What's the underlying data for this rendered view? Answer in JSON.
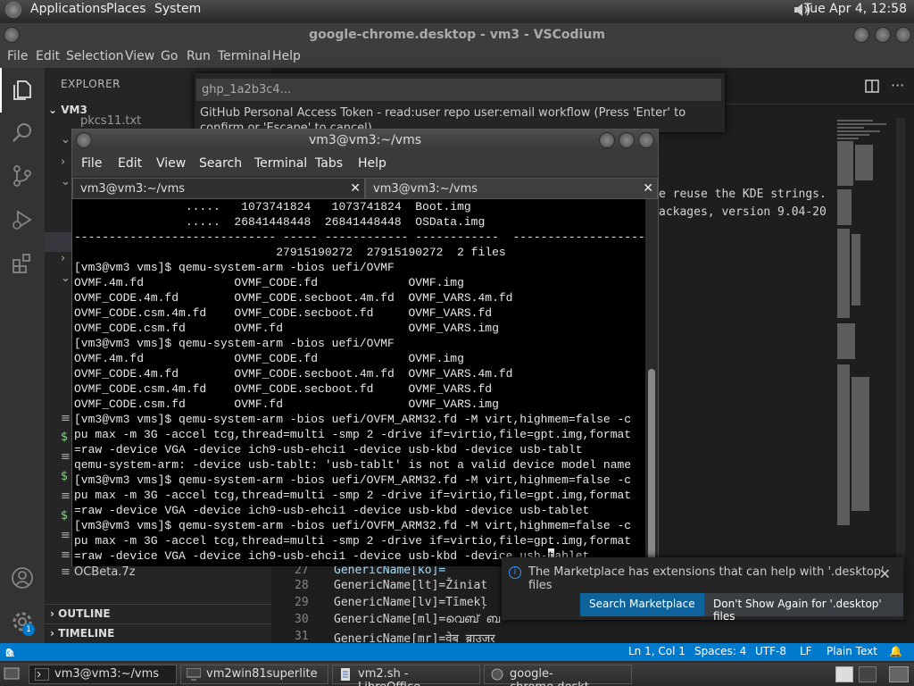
{
  "top_panel": {
    "menus": [
      "Applications",
      "Places",
      "System"
    ],
    "clock": "Tue Apr  4, 12:58"
  },
  "vscodium": {
    "window_title": "google-chrome.desktop - vm3 - VSCodium",
    "menubar": [
      "File",
      "Edit",
      "Selection",
      "View",
      "Go",
      "Run",
      "Terminal",
      "Help"
    ],
    "explorer_title": "EXPLORER",
    "folder_name": "VM3",
    "partial_file_top": "pkcs11.txt",
    "partial_file_bottom": "OCBeta.7z",
    "outline_label": "OUTLINE",
    "timeline_label": "TIMELINE",
    "settings_badge": "1",
    "editor_right_lines": [
      "e reuse the KDE strings.",
      "ackages, version 9.04-20"
    ],
    "gutter_lines": [
      {
        "num": "27",
        "text": "GenericName[ko]="
      },
      {
        "num": "28",
        "text": "GenericName[lt]=Žiniat"
      },
      {
        "num": "29",
        "text": "GenericName[lv]=Tīmekļ"
      },
      {
        "num": "30",
        "text": "GenericName[ml]=വെബ് ബ"
      },
      {
        "num": "31",
        "text": "GenericName[mr]=वेब ब्राउजर"
      }
    ]
  },
  "quick_input": {
    "value": "ghp_1a2b3c4...",
    "message": "GitHub Personal Access Token - read:user repo user:email workflow (Press 'Enter' to confirm or 'Escape' to cancel)"
  },
  "terminal": {
    "title": "vm3@vm3:~/vms",
    "menubar": [
      "File",
      "Edit",
      "View",
      "Search",
      "Terminal",
      "Tabs",
      "Help"
    ],
    "tabs": [
      "vm3@vm3:~/vms",
      "vm3@vm3:~/vms"
    ],
    "lines": [
      "                .....   1073741824   1073741824  Boot.img",
      "                .....  26841448448  26841448448  OSData.img",
      "----------------------------- ----- ------------ ------------  ------------------------",
      "                             27915190272  27915190272  2 files",
      "[vm3@vm3 vms]$ qemu-system-arm -bios uefi/OVMF",
      "OVMF.4m.fd             OVMF_CODE.fd             OVMF.img",
      "OVMF_CODE.4m.fd        OVMF_CODE.secboot.4m.fd  OVMF_VARS.4m.fd",
      "OVMF_CODE.csm.4m.fd    OVMF_CODE.secboot.fd     OVMF_VARS.fd",
      "OVMF_CODE.csm.fd       OVMF.fd                  OVMF_VARS.img",
      "[vm3@vm3 vms]$ qemu-system-arm -bios uefi/OVMF",
      "OVMF.4m.fd             OVMF_CODE.fd             OVMF.img",
      "OVMF_CODE.4m.fd        OVMF_CODE.secboot.4m.fd  OVMF_VARS.4m.fd",
      "OVMF_CODE.csm.4m.fd    OVMF_CODE.secboot.fd     OVMF_VARS.fd",
      "OVMF_CODE.csm.fd       OVMF.fd                  OVMF_VARS.img",
      "[vm3@vm3 vms]$ qemu-system-arm -bios uefi/OVFM_ARM32.fd -M virt,highmem=false -c",
      "pu max -m 3G -accel tcg,thread=multi -smp 2 -drive if=virtio,file=gpt.img,format",
      "=raw -device VGA -device ich9-usb-ehci1 -device usb-kbd -device usb-tablt",
      "qemu-system-arm: -device usb-tablt: 'usb-tablt' is not a valid device model name",
      "[vm3@vm3 vms]$ qemu-system-arm -bios uefi/OVFM_ARM32.fd -M virt,highmem=false -c",
      "pu max -m 3G -accel tcg,thread=multi -smp 2 -drive if=virtio,file=gpt.img,format",
      "=raw -device VGA -device ich9-usb-ehci1 -device usb-kbd -device usb-tablet",
      "[vm3@vm3 vms]$ qemu-system-arm -bios uefi/OVFM_ARM32.fd -M virt,highmem=false -c",
      "pu max -m 3G -accel tcg,thread=multi -smp 2 -drive if=virtio,file=gpt.img,format"
    ],
    "last_line_before_cursor": "=raw -device VGA -device ich9-usb-ehci1 -device usb-kbd -device usb-",
    "cursor_char": "t",
    "last_line_after_cursor": "ablet"
  },
  "notification": {
    "message": "The Marketplace has extensions that can help with '.desktop' files",
    "primary_button": "Search Marketplace",
    "secondary_button": "Don't Show Again for '.desktop' files"
  },
  "statusbar": {
    "errors": "0",
    "warnings": "0",
    "position": "Ln 1, Col 1",
    "spaces": "Spaces: 4",
    "encoding": "UTF-8",
    "eol": "LF",
    "language": "Plain Text"
  },
  "taskbar": {
    "tasks": [
      "vm3@vm3:~/vms",
      "vm2win81superlite",
      "vm2.sh - LibreOffice ...",
      "google-chrome.deskt..."
    ]
  },
  "colors": {
    "accent": "#007acc",
    "button_primary": "#0e639c",
    "button_secondary": "#3a3d41"
  }
}
